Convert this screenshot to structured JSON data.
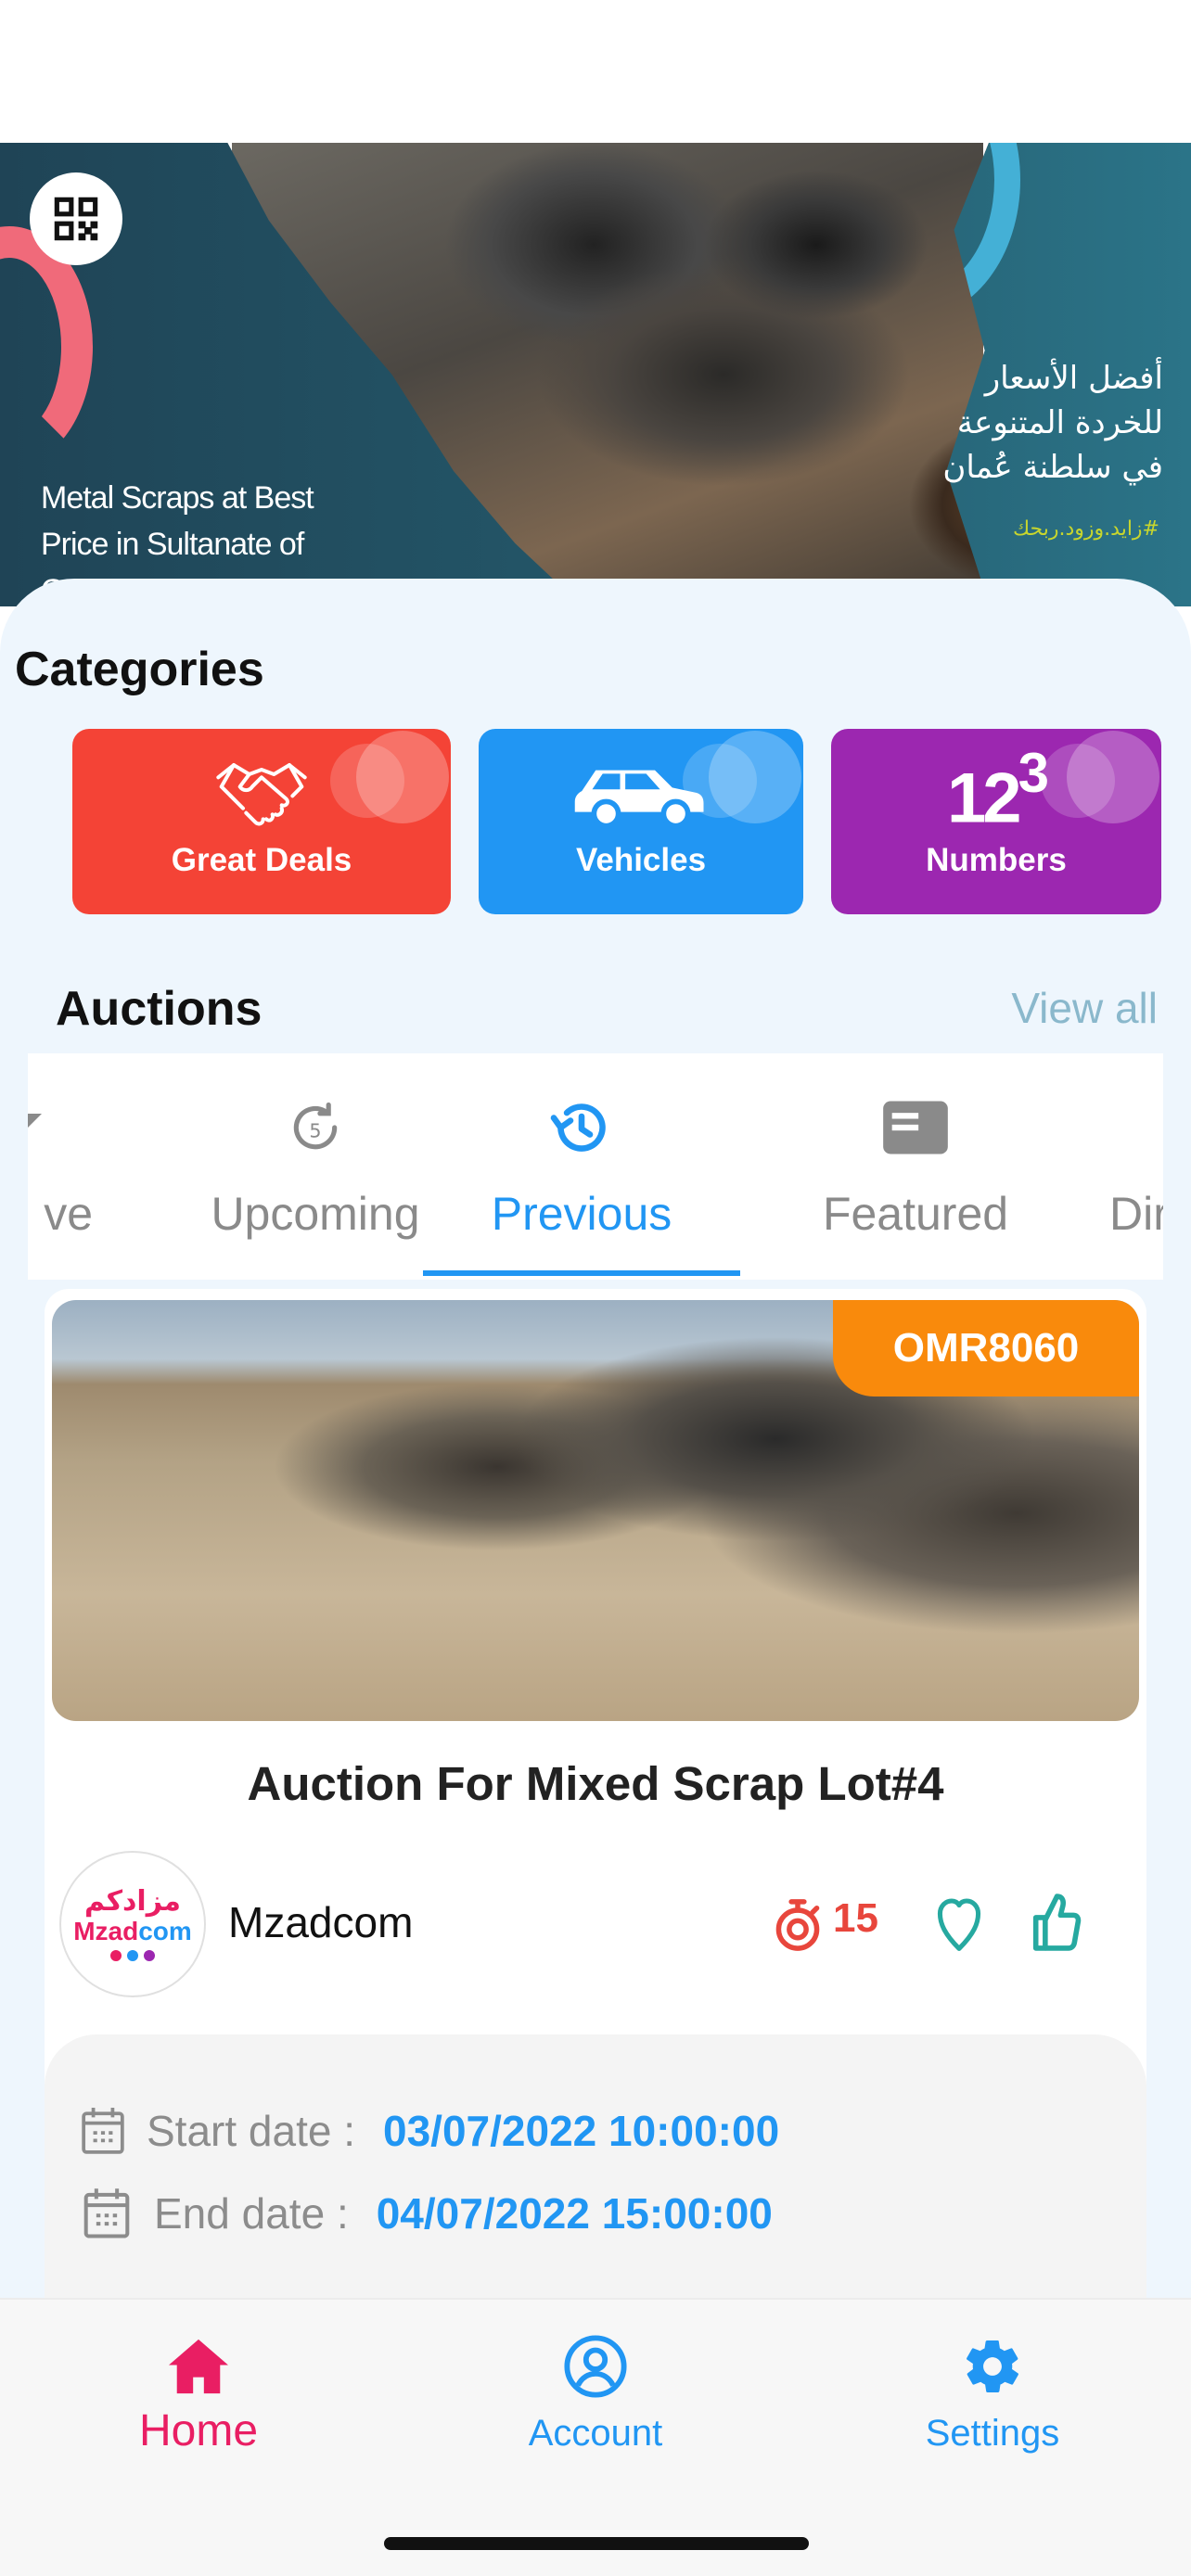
{
  "banner": {
    "english_text": "Metal Scraps at Best Price in Sultanate of Oman",
    "arabic_text": "أفضل الأسعار للخردة المتنوعة في سلطنة عُمان",
    "hashtag": "#زايد.وزود.ربحك",
    "qr_icon": "qr-code-icon"
  },
  "categories": {
    "title": "Categories",
    "items": [
      {
        "label": "Great Deals",
        "icon": "handshake-icon",
        "color": "#f44336"
      },
      {
        "label": "Vehicles",
        "icon": "car-icon",
        "color": "#2196f3"
      },
      {
        "label": "Numbers",
        "icon": "numbers-icon",
        "glyph": "123",
        "color": "#9c27b0"
      }
    ]
  },
  "auctions": {
    "title": "Auctions",
    "view_all": "View all",
    "tabs": [
      {
        "label": "Live",
        "icon": "live-icon",
        "active": false
      },
      {
        "label": "Upcoming",
        "icon": "upcoming-icon",
        "badge": "5",
        "active": false
      },
      {
        "label": "Previous",
        "icon": "history-icon",
        "active": true
      },
      {
        "label": "Featured",
        "icon": "featured-icon",
        "active": false
      },
      {
        "label": "Direct",
        "icon": "direct-icon",
        "active": false
      }
    ],
    "visible_tab_text": [
      "ve",
      "Upcoming",
      "Previous",
      "Featured",
      "Dire"
    ]
  },
  "auction_card": {
    "price": "OMR8060",
    "title": "Auction For Mixed Scrap Lot#4",
    "seller": {
      "name": "Mzadcom",
      "logo_arabic": "مزادكم",
      "logo_en_a": "Mzad",
      "logo_en_b": "com"
    },
    "bid_count": "15",
    "start_label": "Start date :",
    "start_value": "03/07/2022 10:00:00",
    "end_label": "End date :",
    "end_value": "04/07/2022 15:00:00"
  },
  "bottom_nav": [
    {
      "label": "Home",
      "icon": "home-icon",
      "active": true,
      "color": "#e91e63"
    },
    {
      "label": "Account",
      "icon": "account-icon",
      "active": false,
      "color": "#2196f3"
    },
    {
      "label": "Settings",
      "icon": "settings-icon",
      "active": false,
      "color": "#2196f3"
    }
  ]
}
